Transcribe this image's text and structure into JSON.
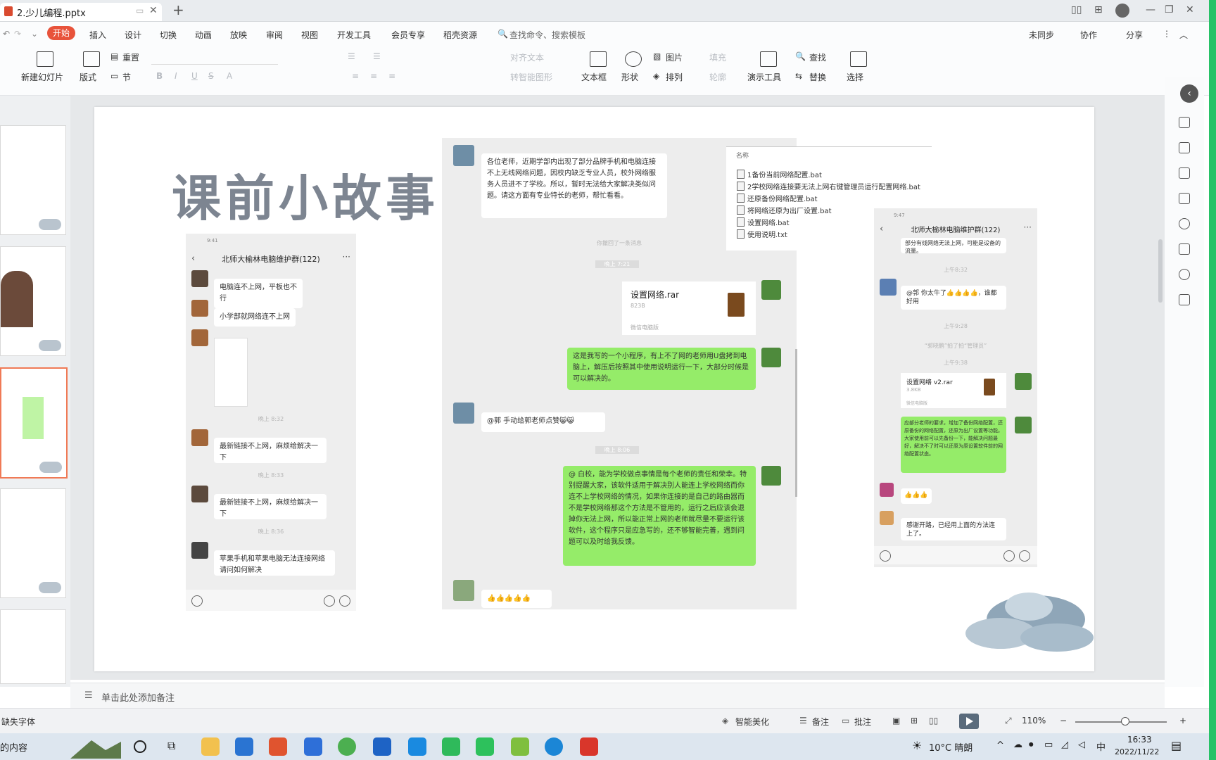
{
  "window": {
    "doc_tab": "2.少儿编程.pptx"
  },
  "menu": {
    "items": [
      "开始",
      "插入",
      "设计",
      "切换",
      "动画",
      "放映",
      "审阅",
      "视图",
      "开发工具",
      "会员专享",
      "稻壳资源"
    ],
    "search": "查找命令、搜索模板",
    "right": [
      "未同步",
      "协作",
      "分享"
    ]
  },
  "ribbon": {
    "new_slide": "新建幻灯片",
    "layout": "版式",
    "section": "节",
    "reset": "重置",
    "text_box": "文本框",
    "shape": "形状",
    "arrange": "排列",
    "picture": "图片",
    "fill": "填充",
    "outline": "轮廓",
    "convert_smartart": "转智能图形",
    "text_direction": "对齐文本",
    "presenter_tools": "演示工具",
    "find": "查找",
    "replace": "替换",
    "select": "选择"
  },
  "slide": {
    "title": "课前小故事",
    "left_chat": {
      "header": "北师大榆林电脑维护群(122)",
      "status": "9:41",
      "messages": [
        "电脑连不上网，平板也不行",
        "小学部就网络连不上网",
        "最新链接不上网，麻烦给解决一下",
        "最新链接不上网，麻烦给解决一下",
        "苹果手机和苹果电脑无法连接网络请问如何解决"
      ],
      "sys": [
        "晚上 8:32",
        "晚上 8:33",
        "晚上 8:36"
      ]
    },
    "middle_chat": {
      "notice": "各位老师，近期学部内出现了部分品牌手机和电脑连接不上无线网络问题，因校内缺乏专业人员，校外网络服务人员进不了学校。所以，暂时无法给大家解决类似问题。请这方面有专业特长的老师，帮忙看看。",
      "sys_recall": "你撤回了一条消息",
      "sys_time1": "晚上 7:21",
      "rar_name": "设置网络.rar",
      "rar_size": "823B",
      "rar_source": "微信电脑版",
      "green1": "这是我写的一个小程序，有上不了网的老师用U盘拷到电脑上，解压后按照其中使用说明运行一下，大部分时候是可以解决的。",
      "reply": "@郭 手动给郭老师点赞😸😸",
      "sys_time2": "晚上 8:06",
      "green2": "@ 白校，能为学校做点事情是每个老师的责任和荣幸。特别提醒大家，该软件适用于解决别人能连上学校网络而你连不上学校网络的情况，如果你连接的是自己的路由器而不是学校网络那这个方法是不管用的，运行之后应该会退掉你无法上网，所以能正常上网的老师就尽量不要运行该软件，这个程序只是应急写的，还不够智能完善，遇到问题可以及时给我反馈。",
      "thumbs": "👍👍👍👍👍"
    },
    "file_list": {
      "header": "名称",
      "files": [
        "1备份当前网络配置.bat",
        "2学校网络连接要无法上网右键管理员运行配置网络.bat",
        "还原备份网络配置.bat",
        "将网络还原为出厂设置.bat",
        "设置网络.bat",
        "使用说明.txt"
      ]
    },
    "right_chat": {
      "header": "北师大榆林电脑维护群(122)",
      "status": "9:47",
      "top_text": "部分有线网络无法上网，可能是设备的流量。",
      "sys1": "上午8:32",
      "reply1": "@郭 你太牛了👍👍👍👍，谁都好用",
      "sys2": "上午9:28",
      "sys3": "“郭晓鹏”拍了拍“管理员”",
      "sys4": "上午9:38",
      "rar_name": "设置网络 v2.rar",
      "rar_size": "3.8KB",
      "rar_source": "微信电脑版",
      "green": "应部分老师的要求，增加了备份网络配置，还原备份的网络配置，还原为出厂设置等功能。大家使用前可以先备份一下，能解决问题最好，解决不了时可以还原为原设置软件前的网络配置状态。",
      "thumbs": "👍👍👍",
      "last": "感谢开路，已经用上面的方法连上了。"
    }
  },
  "notes": {
    "placeholder": "单击此处添加备注"
  },
  "status": {
    "left": "缺失字体",
    "smart_beautify": "智能美化",
    "notes_btn": "备注",
    "comments_btn": "批注",
    "zoom": "110%"
  },
  "taskbar": {
    "search": "的内容",
    "weather": "10°C 晴朗",
    "ime": "中",
    "time": "16:33",
    "date": "2022/11/22"
  },
  "colors": {
    "accent": "#e8533b",
    "wechat_green": "#95ec69",
    "title_gray": "#7d8591",
    "edge_green": "#27c267"
  }
}
